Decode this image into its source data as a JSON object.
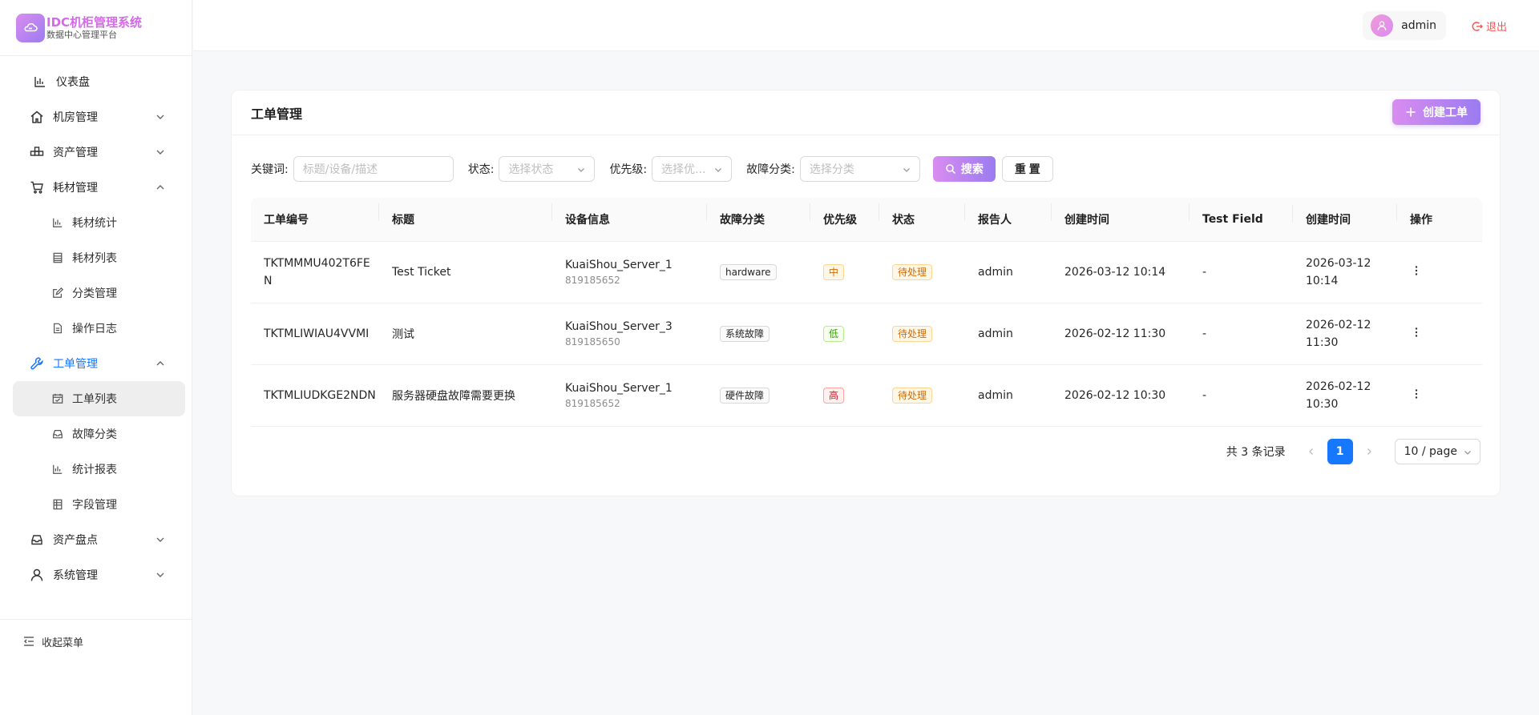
{
  "brand": {
    "title": "IDC机柜管理系统",
    "subtitle": "数据中心管理平台"
  },
  "sidebar": {
    "items": [
      {
        "label": "仪表盘",
        "icon": "bar-chart-icon"
      },
      {
        "label": "机房管理",
        "icon": "home-icon"
      },
      {
        "label": "资产管理",
        "icon": "cluster-icon"
      },
      {
        "label": "耗材管理",
        "icon": "cart-icon"
      },
      {
        "label": "工单管理",
        "icon": "wrench-icon"
      },
      {
        "label": "资产盘点",
        "icon": "inbox-icon"
      },
      {
        "label": "系统管理",
        "icon": "user-icon"
      }
    ],
    "consumables_sub": [
      {
        "label": "耗材统计",
        "icon": "bar-chart-icon"
      },
      {
        "label": "耗材列表",
        "icon": "table-icon"
      },
      {
        "label": "分类管理",
        "icon": "form-icon"
      },
      {
        "label": "操作日志",
        "icon": "file-icon"
      }
    ],
    "tickets_sub": [
      {
        "label": "工单列表",
        "icon": "schedule-icon"
      },
      {
        "label": "故障分类",
        "icon": "inbox-icon"
      },
      {
        "label": "统计报表",
        "icon": "bar-chart-icon"
      },
      {
        "label": "字段管理",
        "icon": "table-icon"
      }
    ],
    "collapse_label": "收起菜单"
  },
  "header": {
    "username": "admin",
    "logout_label": "退出"
  },
  "card": {
    "title": "工单管理",
    "create_label": "创建工单"
  },
  "filters": {
    "keyword_label": "关键词:",
    "keyword_placeholder": "标题/设备/描述",
    "status_label": "状态:",
    "status_placeholder": "选择状态",
    "priority_label": "优先级:",
    "priority_placeholder": "选择优...",
    "category_label": "故障分类:",
    "category_placeholder": "选择分类",
    "search_label": "搜索",
    "reset_label": "重 置"
  },
  "table": {
    "columns": [
      "工单编号",
      "标题",
      "设备信息",
      "故障分类",
      "优先级",
      "状态",
      "报告人",
      "创建时间",
      "Test Field",
      "创建时间",
      "操作"
    ],
    "rows": [
      {
        "id_line1": "TKTMMMU402T6FE",
        "id_line2": "N",
        "title": "Test Ticket",
        "device_name": "KuaiShou_Server_1",
        "device_sn": "819185652",
        "category": "hardware",
        "priority": "中",
        "priority_level": "medium",
        "status": "待处理",
        "reporter": "admin",
        "created": "2026-03-12 10:14",
        "test_field": "-",
        "created2_line1": "2026-03-12",
        "created2_line2": "10:14"
      },
      {
        "id_line1": "TKTMLIWIAU4VVMI",
        "id_line2": "",
        "title": "测试",
        "device_name": "KuaiShou_Server_3",
        "device_sn": "819185650",
        "category": "系统故障",
        "priority": "低",
        "priority_level": "low",
        "status": "待处理",
        "reporter": "admin",
        "created": "2026-02-12 11:30",
        "test_field": "-",
        "created2_line1": "2026-02-12",
        "created2_line2": "11:30"
      },
      {
        "id_line1": "TKTMLIUDKGE2NDN",
        "id_line2": "",
        "title": "服务器硬盘故障需要更换",
        "device_name": "KuaiShou_Server_1",
        "device_sn": "819185652",
        "category": "硬件故障",
        "priority": "高",
        "priority_level": "high",
        "status": "待处理",
        "reporter": "admin",
        "created": "2026-02-12 10:30",
        "test_field": "-",
        "created2_line1": "2026-02-12",
        "created2_line2": "10:30"
      }
    ]
  },
  "pagination": {
    "total_text": "共 3 条记录",
    "current_page": "1",
    "page_size": "10 / page"
  },
  "colors": {
    "accent_purple": "#d98cf0",
    "accent_blue": "#1677ff",
    "danger": "#ff4d4f"
  }
}
